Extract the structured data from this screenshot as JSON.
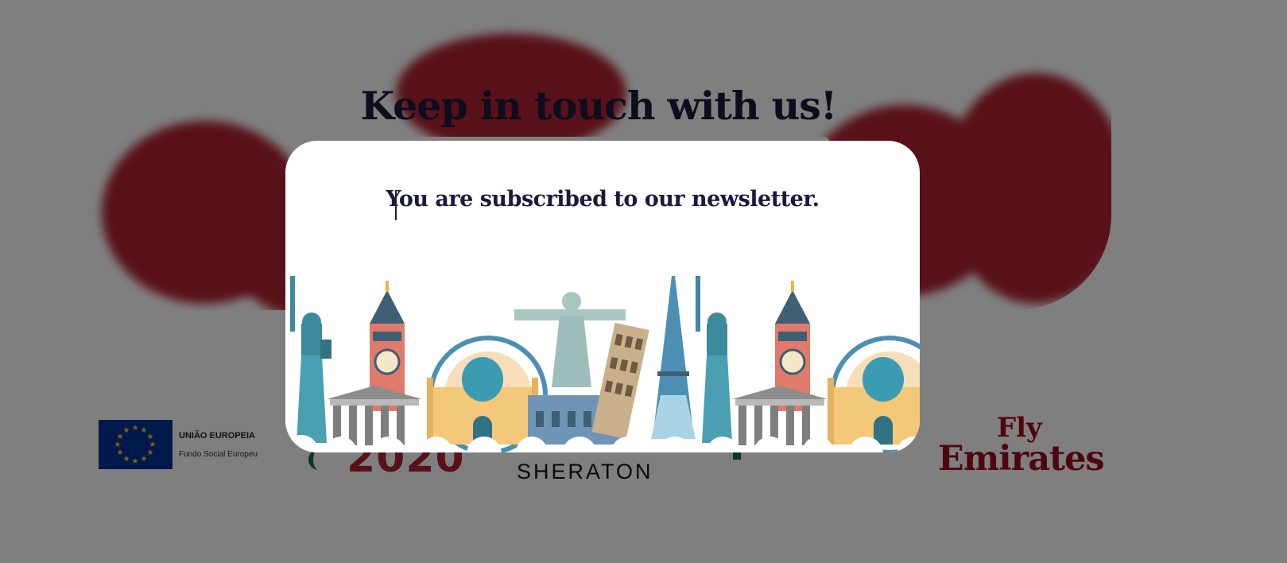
{
  "hero": {
    "title": "Keep in touch with us!"
  },
  "modal": {
    "message": "You are subscribed to our newsletter."
  },
  "partners": {
    "eu_title": "UNIÃO EUROPEIA",
    "eu_subtitle": "Fundo Social Europeu",
    "logo_2020": "2020",
    "sheraton": "SHERATON",
    "fly": "Fly",
    "emirates": "Emirates"
  },
  "colors": {
    "brand_red": "#b22332",
    "navy_text": "#1a1a3d",
    "overlay": "rgba(0,0,0,0.5)",
    "emirates_red": "#9e0b1a"
  },
  "icons": {
    "eu_flag": "eu-flag-icon",
    "skyline": "world-landmarks-illustration"
  }
}
